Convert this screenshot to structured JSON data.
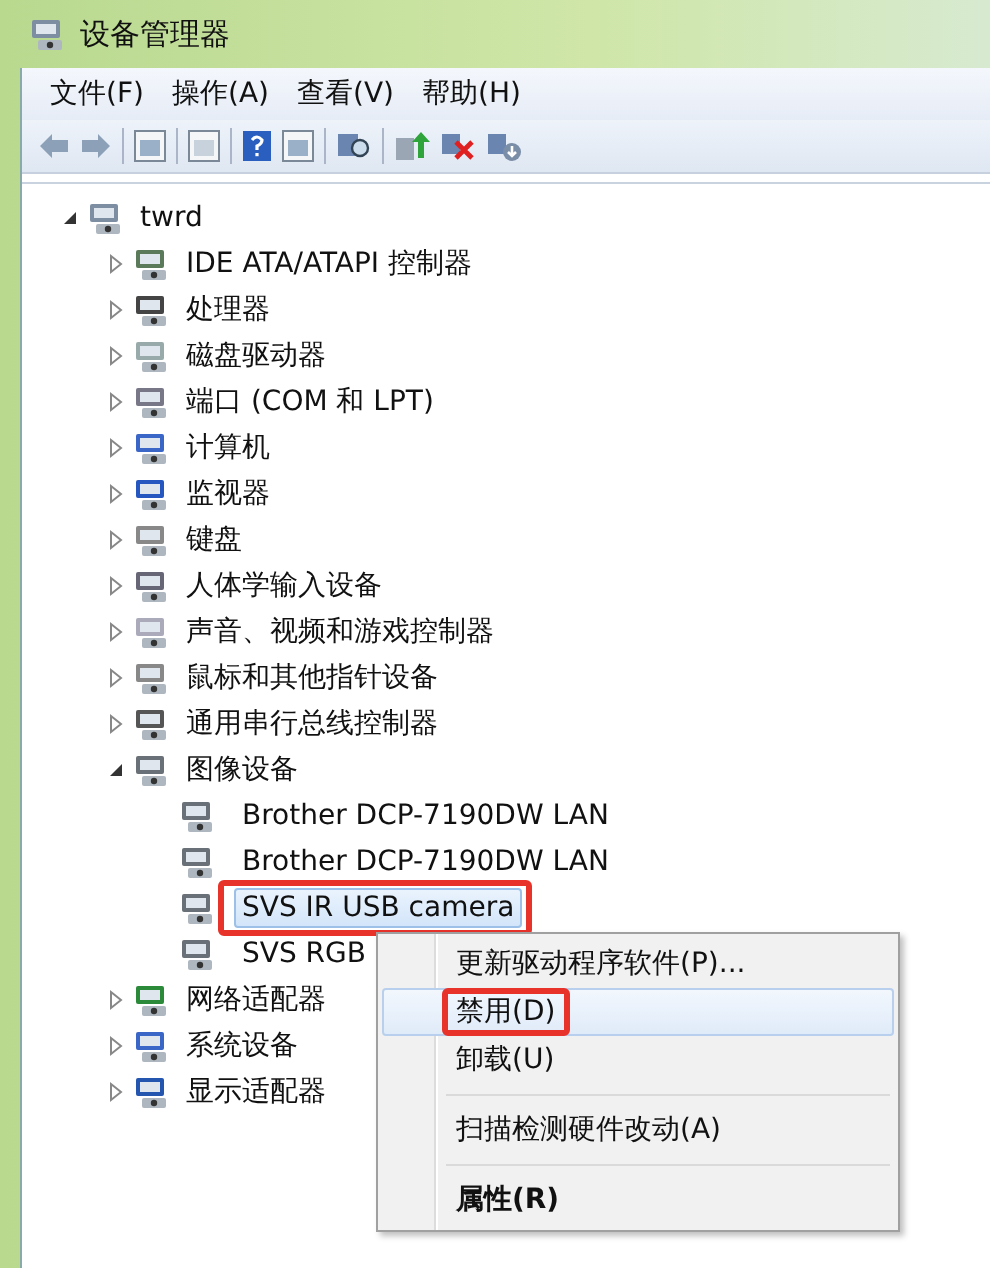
{
  "window": {
    "title": "设备管理器"
  },
  "menu_bar": [
    "文件(F)",
    "操作(A)",
    "查看(V)",
    "帮助(H)"
  ],
  "toolbar": [
    {
      "kind": "back"
    },
    {
      "kind": "forward"
    },
    {
      "kind": "sep"
    },
    {
      "kind": "pane"
    },
    {
      "kind": "sep"
    },
    {
      "kind": "sheet"
    },
    {
      "kind": "sep"
    },
    {
      "kind": "help"
    },
    {
      "kind": "pane2"
    },
    {
      "kind": "sep"
    },
    {
      "kind": "scan"
    },
    {
      "kind": "sep"
    },
    {
      "kind": "update"
    },
    {
      "kind": "disable"
    },
    {
      "kind": "uninstall"
    }
  ],
  "tree": [
    {
      "label": "twrd",
      "kind": "computer",
      "expanded": true,
      "children": [
        {
          "label": "IDE ATA/ATAPI 控制器",
          "kind": "ide",
          "expanded": false
        },
        {
          "label": "处理器",
          "kind": "cpu",
          "expanded": false
        },
        {
          "label": "磁盘驱动器",
          "kind": "disk",
          "expanded": false
        },
        {
          "label": "端口 (COM 和 LPT)",
          "kind": "port",
          "expanded": false
        },
        {
          "label": "计算机",
          "kind": "pc",
          "expanded": false
        },
        {
          "label": "监视器",
          "kind": "monitor",
          "expanded": false
        },
        {
          "label": "键盘",
          "kind": "keyboard",
          "expanded": false
        },
        {
          "label": "人体学输入设备",
          "kind": "hid",
          "expanded": false
        },
        {
          "label": "声音、视频和游戏控制器",
          "kind": "sound",
          "expanded": false
        },
        {
          "label": "鼠标和其他指针设备",
          "kind": "mouse",
          "expanded": false
        },
        {
          "label": "通用串行总线控制器",
          "kind": "usb",
          "expanded": false
        },
        {
          "label": "图像设备",
          "kind": "camera",
          "expanded": true,
          "children": [
            {
              "label": "Brother DCP-7190DW LAN",
              "kind": "camera",
              "selected": false,
              "highlighted": false
            },
            {
              "label": "Brother DCP-7190DW LAN",
              "kind": "camera",
              "selected": false,
              "highlighted": false
            },
            {
              "label": "SVS IR USB camera",
              "kind": "camera",
              "selected": true,
              "highlighted": true
            },
            {
              "label": "SVS RGB",
              "kind": "camera",
              "selected": false,
              "highlighted": false
            }
          ]
        },
        {
          "label": "网络适配器",
          "kind": "network",
          "expanded": false
        },
        {
          "label": "系统设备",
          "kind": "pc",
          "expanded": false
        },
        {
          "label": "显示适配器",
          "kind": "display",
          "expanded": false
        }
      ]
    }
  ],
  "context_menu": [
    {
      "kind": "item",
      "label": "更新驱动程序软件(P)...",
      "selected": false,
      "highlighted": false,
      "bold": false
    },
    {
      "kind": "item",
      "label": "禁用(D)",
      "selected": true,
      "highlighted": true,
      "bold": false
    },
    {
      "kind": "item",
      "label": "卸载(U)",
      "selected": false,
      "highlighted": false,
      "bold": false
    },
    {
      "kind": "separator"
    },
    {
      "kind": "item",
      "label": "扫描检测硬件改动(A)",
      "selected": false,
      "highlighted": false,
      "bold": false
    },
    {
      "kind": "separator"
    },
    {
      "kind": "item",
      "label": "属性(R)",
      "selected": false,
      "highlighted": false,
      "bold": true
    }
  ]
}
